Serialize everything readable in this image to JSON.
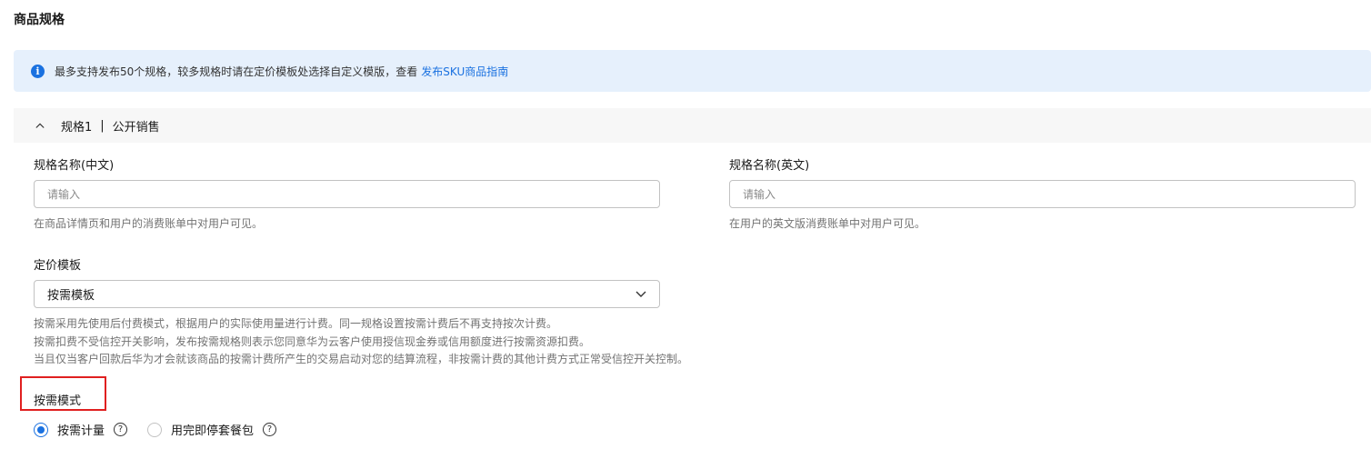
{
  "page": {
    "title": "商品规格"
  },
  "banner": {
    "text": "最多支持发布50个规格，较多规格时请在定价模板处选择自定义模版，查看",
    "link": "发布SKU商品指南",
    "icon": "info-icon",
    "accent": "#1a71e0",
    "background": "#e6f0fc"
  },
  "spec": {
    "title": "规格1",
    "separator": "|",
    "status": "公开销售",
    "icon": "chevron-up-icon"
  },
  "fields": {
    "name_cn": {
      "label": "规格名称(中文)",
      "placeholder": "请输入",
      "value": "",
      "hint": "在商品详情页和用户的消费账单中对用户可见。"
    },
    "name_en": {
      "label": "规格名称(英文)",
      "placeholder": "请输入",
      "value": "",
      "hint": "在用户的英文版消费账单中对用户可见。"
    },
    "pricing": {
      "label": "定价模板",
      "selected": "按需模板",
      "hints": [
        "按需采用先使用后付费模式，根据用户的实际使用量进行计费。同一规格设置按需计费后不再支持按次计费。",
        "按需扣费不受信控开关影响，发布按需规格则表示您同意华为云客户使用授信现金券或信用额度进行按需资源扣费。",
        "当且仅当客户回款后华为才会就该商品的按需计费所产生的交易启动对您的结算流程，非按需计费的其他计费方式正常受信控开关控制。"
      ]
    },
    "mode": {
      "label": "按需模式",
      "options": [
        {
          "label": "按需计量",
          "checked": true
        },
        {
          "label": "用完即停套餐包",
          "checked": false
        }
      ],
      "help_glyph": "?"
    }
  },
  "colors": {
    "primary": "#1a71e0",
    "highlight": "#e02020",
    "hint_text": "#737373"
  }
}
